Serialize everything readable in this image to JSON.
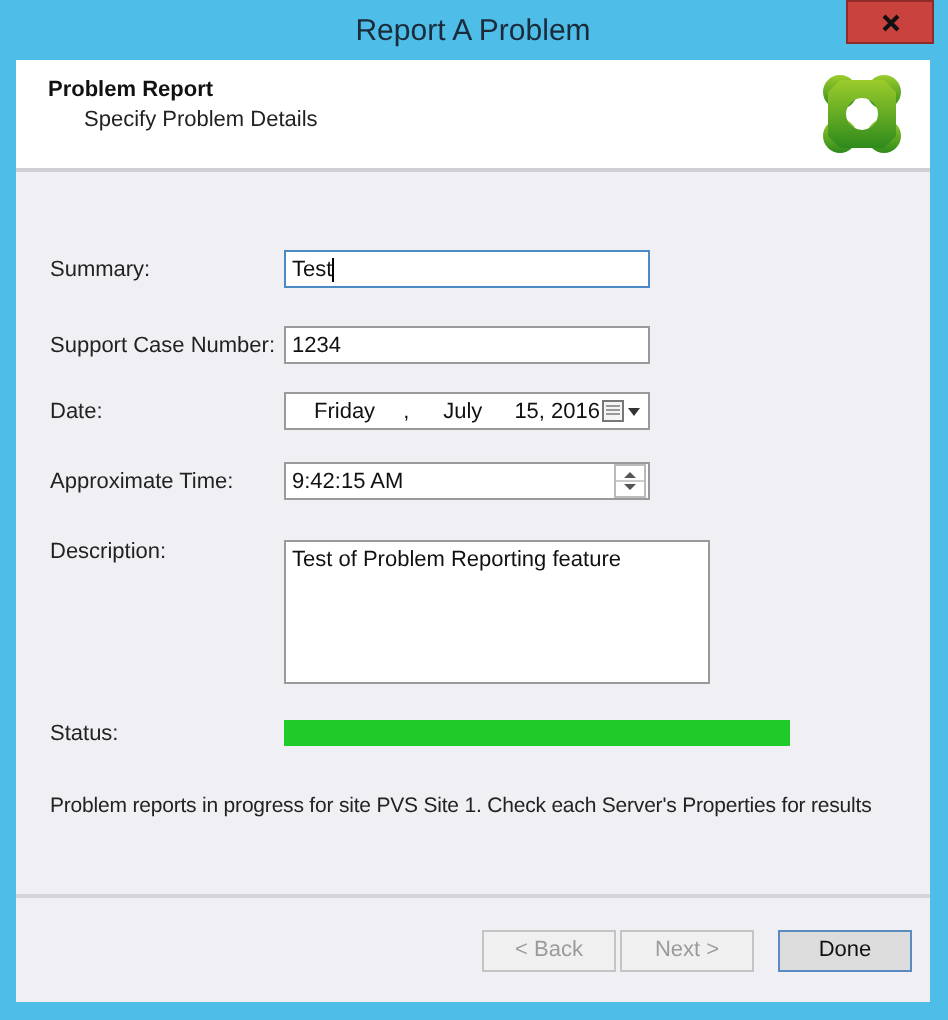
{
  "window": {
    "title": "Report A Problem"
  },
  "header": {
    "title": "Problem Report",
    "subtitle": "Specify Problem Details"
  },
  "fields": [
    {
      "kind": "text",
      "label": "Summary:",
      "value": "Test",
      "focused": true
    },
    {
      "kind": "text",
      "label": "Support Case Number:",
      "value": "1234",
      "focused": false
    },
    {
      "kind": "date",
      "label": "Date:",
      "weekday": "Friday",
      "separator": ",",
      "month": "July",
      "day_year": "15, 2016"
    },
    {
      "kind": "time",
      "label": "Approximate Time:",
      "value": "9:42:15 AM"
    },
    {
      "kind": "textarea",
      "label": "Description:",
      "value": "Test of Problem Reporting feature"
    },
    {
      "kind": "progress",
      "label": "Status:",
      "level": 1
    }
  ],
  "message": "Problem reports in progress for site PVS Site 1. Check each Server's Properties for results",
  "buttons": [
    {
      "label": "< Back",
      "disabled": true,
      "default": false
    },
    {
      "label": "Next >",
      "disabled": true,
      "default": false
    },
    {
      "label": "Done",
      "disabled": false,
      "default": true
    }
  ]
}
